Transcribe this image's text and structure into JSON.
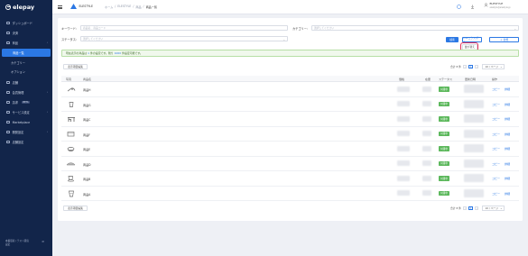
{
  "sidebar": {
    "logo": "elepay",
    "items": [
      {
        "label": "ダッシュボード",
        "active": false,
        "sub": false
      },
      {
        "label": "決済",
        "active": false,
        "sub": false
      },
      {
        "label": "商品",
        "active": false,
        "sub": false,
        "expanded": true
      },
      {
        "label": "商品一覧",
        "active": true,
        "sub": true
      },
      {
        "label": "カテゴリー",
        "active": false,
        "sub": true
      },
      {
        "label": "オプション",
        "active": false,
        "sub": true
      },
      {
        "label": "店舗",
        "active": false,
        "sub": false
      },
      {
        "label": "会員管理",
        "active": false,
        "sub": false
      },
      {
        "label": "請求",
        "active": false,
        "sub": false,
        "badge": "BETA"
      },
      {
        "label": "サービス設定",
        "active": false,
        "sub": false
      },
      {
        "label": "Marketplace",
        "active": false,
        "sub": false
      },
      {
        "label": "開発設定",
        "active": false,
        "sub": false
      },
      {
        "label": "店舗設定",
        "active": false,
        "sub": false
      }
    ],
    "footer_line1": "本番環境 / テスト環境",
    "footer_line2": "設定",
    "collapse": "≪"
  },
  "topbar": {
    "brand": "ELESTYLE",
    "breadcrumb": [
      "ホーム",
      "ELESTYLE",
      "商品"
    ],
    "breadcrumb_current": "商品一覧",
    "user_name": "ELESTYLE",
    "user_sub": "elestyle@elestyle.jp"
  },
  "filters": {
    "keyword_label": "キーワード：",
    "keyword_placeholder": "商品名、商品コード",
    "category_label": "カテゴリー：",
    "category_placeholder": "選択してください",
    "status_label": "ステータス：",
    "status_placeholder": "選択してください"
  },
  "buttons": {
    "search": "検索",
    "csv_export": "CSVエクスポート",
    "add": "＋ 新規",
    "order": "並び替え"
  },
  "notice": {
    "text_before": "現在表示の商品は ",
    "link": "1",
    "text_middle": " 件の設定です。残り ",
    "link2": "1000",
    "text_after": " 件設定可能です。"
  },
  "bulk": {
    "label": "表示項目編集"
  },
  "pagination": {
    "total": "合計 8 件",
    "prev": "‹",
    "current": "1",
    "next": "›",
    "per_page": "10 / ページ"
  },
  "table": {
    "headers": [
      "写真",
      "商品名",
      "価格",
      "在庫",
      "ステータス",
      "更新日時",
      "操作"
    ],
    "rows": [
      {
        "name": "商品H",
        "status": "公開中",
        "copy": "コピー",
        "detail": "詳細",
        "icon": "hand-item-icon"
      },
      {
        "name": "商品G",
        "status": "公開中",
        "copy": "コピー",
        "detail": "詳細",
        "icon": "cup-icon"
      },
      {
        "name": "商品C",
        "status": "公開中",
        "copy": "コピー",
        "detail": "詳細",
        "icon": "desk-icon"
      },
      {
        "name": "商品F",
        "status": "公開中",
        "copy": "コピー",
        "detail": "詳細",
        "icon": "box-icon"
      },
      {
        "name": "商品E",
        "status": "公開中",
        "copy": "コピー",
        "detail": "詳細",
        "icon": "bowl-icon"
      },
      {
        "name": "商品D",
        "status": "公開中",
        "copy": "コピー",
        "detail": "詳細",
        "icon": "dish-icon"
      },
      {
        "name": "商品B",
        "status": "公開中",
        "copy": "コピー",
        "detail": "詳細",
        "icon": "cup-saucer-icon"
      },
      {
        "name": "商品A",
        "status": "公開中",
        "copy": "コピー",
        "detail": "詳細",
        "icon": "glass-icon"
      }
    ]
  },
  "colors": {
    "accent": "#2b78e4",
    "sidebar": "#12254a",
    "success": "#5cb85c",
    "highlight": "#e4335c"
  }
}
